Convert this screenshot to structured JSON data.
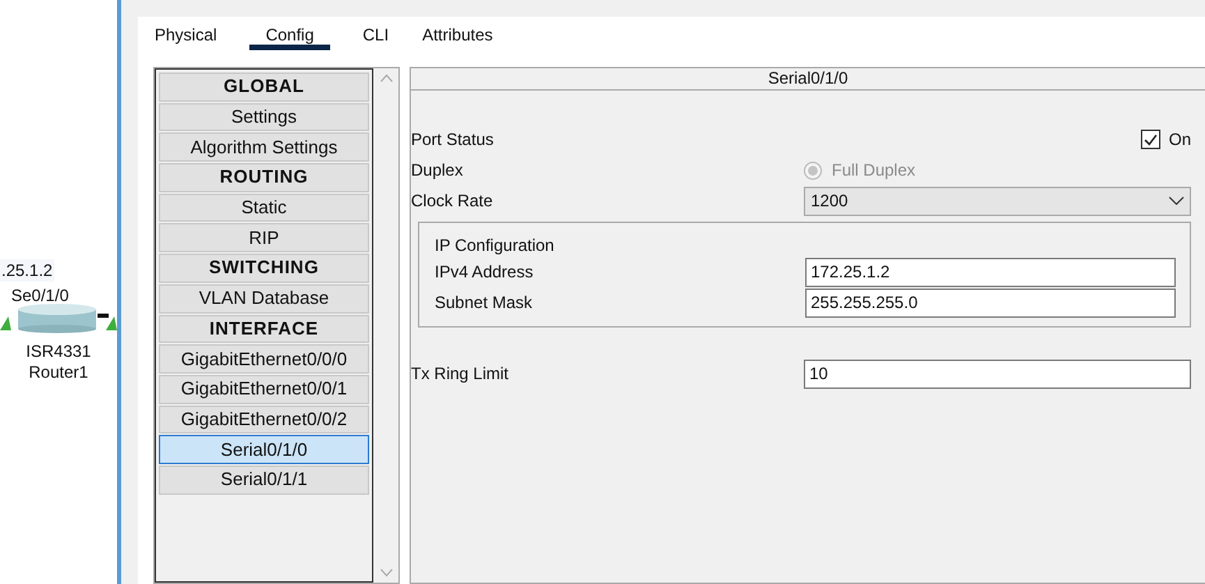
{
  "canvas": {
    "address_label": ".25.1.2",
    "port_label": "Se0/1/0",
    "device_model": "ISR4331",
    "device_name": "Router1"
  },
  "tabs": [
    {
      "label": "Physical",
      "selected": false
    },
    {
      "label": "Config",
      "selected": true
    },
    {
      "label": "CLI",
      "selected": false
    },
    {
      "label": "Attributes",
      "selected": false
    }
  ],
  "sidebar": {
    "items": [
      {
        "label": "GLOBAL",
        "kind": "header",
        "selected": false
      },
      {
        "label": "Settings",
        "kind": "item",
        "selected": false
      },
      {
        "label": "Algorithm Settings",
        "kind": "item",
        "selected": false
      },
      {
        "label": "ROUTING",
        "kind": "header",
        "selected": false
      },
      {
        "label": "Static",
        "kind": "item",
        "selected": false
      },
      {
        "label": "RIP",
        "kind": "item",
        "selected": false
      },
      {
        "label": "SWITCHING",
        "kind": "header",
        "selected": false
      },
      {
        "label": "VLAN Database",
        "kind": "item",
        "selected": false
      },
      {
        "label": "INTERFACE",
        "kind": "header",
        "selected": false
      },
      {
        "label": "GigabitEthernet0/0/0",
        "kind": "item",
        "selected": false
      },
      {
        "label": "GigabitEthernet0/0/1",
        "kind": "item",
        "selected": false
      },
      {
        "label": "GigabitEthernet0/0/2",
        "kind": "item",
        "selected": false
      },
      {
        "label": "Serial0/1/0",
        "kind": "item",
        "selected": true
      },
      {
        "label": "Serial0/1/1",
        "kind": "item",
        "selected": false
      }
    ]
  },
  "panel": {
    "title": "Serial0/1/0",
    "port_status": {
      "label": "Port Status",
      "checked": true,
      "checkbox_label": "On"
    },
    "duplex": {
      "label": "Duplex",
      "option": "Full Duplex",
      "selected": true,
      "disabled": true
    },
    "clock_rate": {
      "label": "Clock Rate",
      "value": "1200"
    },
    "ip_configuration": {
      "title": "IP Configuration",
      "fields": [
        {
          "label": "IPv4 Address",
          "value": "172.25.1.2"
        },
        {
          "label": "Subnet Mask",
          "value": "255.255.255.0"
        }
      ]
    },
    "tx_ring_limit": {
      "label": "Tx Ring Limit",
      "value": "10"
    }
  }
}
